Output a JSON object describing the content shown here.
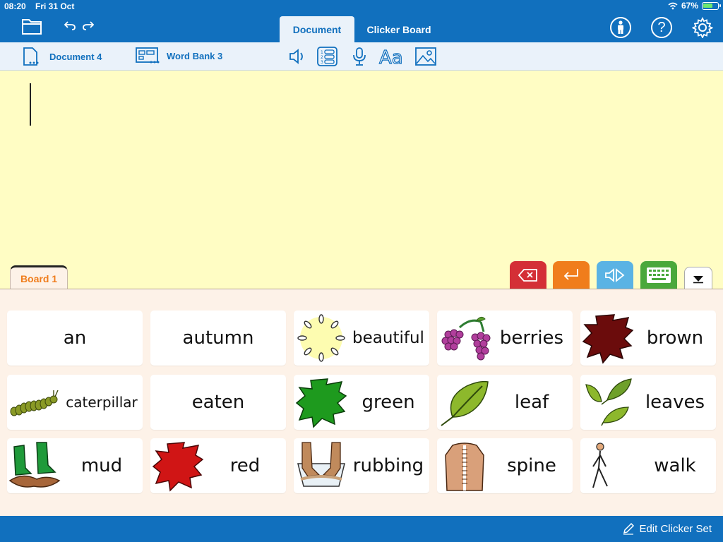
{
  "status": {
    "time": "08:20",
    "date": "Fri 31 Oct",
    "battery": "67%",
    "battery_level": 0.67
  },
  "header": {
    "tabs": [
      {
        "label": "Document",
        "active": true
      },
      {
        "label": "Clicker Board",
        "active": false
      }
    ],
    "icons": [
      "folder-icon",
      "undo-icon",
      "redo-icon",
      "person-icon",
      "help-icon",
      "gear-icon"
    ]
  },
  "subbar": {
    "document_label": "Document 4",
    "wordbank_label": "Word Bank 3",
    "tools": [
      "speaker-icon",
      "numbered-list-icon",
      "microphone-icon",
      "font-icon",
      "image-icon"
    ]
  },
  "board": {
    "tab_label": "Board 1",
    "controls": [
      "backspace-icon",
      "enter-icon",
      "speak-icon",
      "keyboard-icon",
      "collapse-icon"
    ],
    "colors": {
      "backspace": "#d42f36",
      "enter": "#f07d1c",
      "speak": "#5ab3e4",
      "keyboard": "#4aa83b"
    }
  },
  "cells": [
    {
      "word": "an",
      "icon": ""
    },
    {
      "word": "autumn",
      "icon": ""
    },
    {
      "word": "beautiful",
      "icon": "sparkle-icon"
    },
    {
      "word": "berries",
      "icon": "berries-icon"
    },
    {
      "word": "brown",
      "icon": "brown-blob-icon"
    },
    {
      "word": "caterpillar",
      "icon": "caterpillar-icon"
    },
    {
      "word": "eaten",
      "icon": ""
    },
    {
      "word": "green",
      "icon": "green-blob-icon"
    },
    {
      "word": "leaf",
      "icon": "leaf-icon"
    },
    {
      "word": "leaves",
      "icon": "leaves-icon"
    },
    {
      "word": "mud",
      "icon": "muddy-boots-icon"
    },
    {
      "word": "red",
      "icon": "red-blob-icon"
    },
    {
      "word": "rubbing",
      "icon": "hands-rubbing-icon"
    },
    {
      "word": "spine",
      "icon": "spine-icon"
    },
    {
      "word": "walk",
      "icon": "walking-person-icon"
    }
  ],
  "footer": {
    "edit_label": "Edit Clicker Set"
  }
}
